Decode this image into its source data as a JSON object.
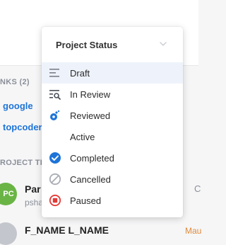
{
  "background": {
    "links_heading": "NKS (2)",
    "links": [
      "google",
      "topcoder"
    ],
    "team_heading": "ROJECT TE",
    "member": {
      "avatar_initials": "PC",
      "name": "Par",
      "handle": "psha"
    },
    "member2": {
      "name": "F_NAME L_NAME"
    },
    "right_fragment_top": "C",
    "right_fragment_bottom": "Mau"
  },
  "dropdown": {
    "title": "Project Status",
    "items": [
      {
        "label": "Draft",
        "icon": "draft-lines-icon"
      },
      {
        "label": "In Review",
        "icon": "review-search-icon"
      },
      {
        "label": "Reviewed",
        "icon": "reviewed-pin-icon"
      },
      {
        "label": "Active",
        "icon": ""
      },
      {
        "label": "Completed",
        "icon": "check-circle-icon"
      },
      {
        "label": "Cancelled",
        "icon": "cancelled-circle-icon"
      },
      {
        "label": "Paused",
        "icon": "paused-circle-icon"
      }
    ],
    "colors": {
      "accent": "#1e74d8",
      "completed": "#1e74d8",
      "paused": "#e53935",
      "cancelled": "#a9adb5",
      "icon_gray": "#7a7f88",
      "hover_bg": "#eef3fb"
    }
  }
}
